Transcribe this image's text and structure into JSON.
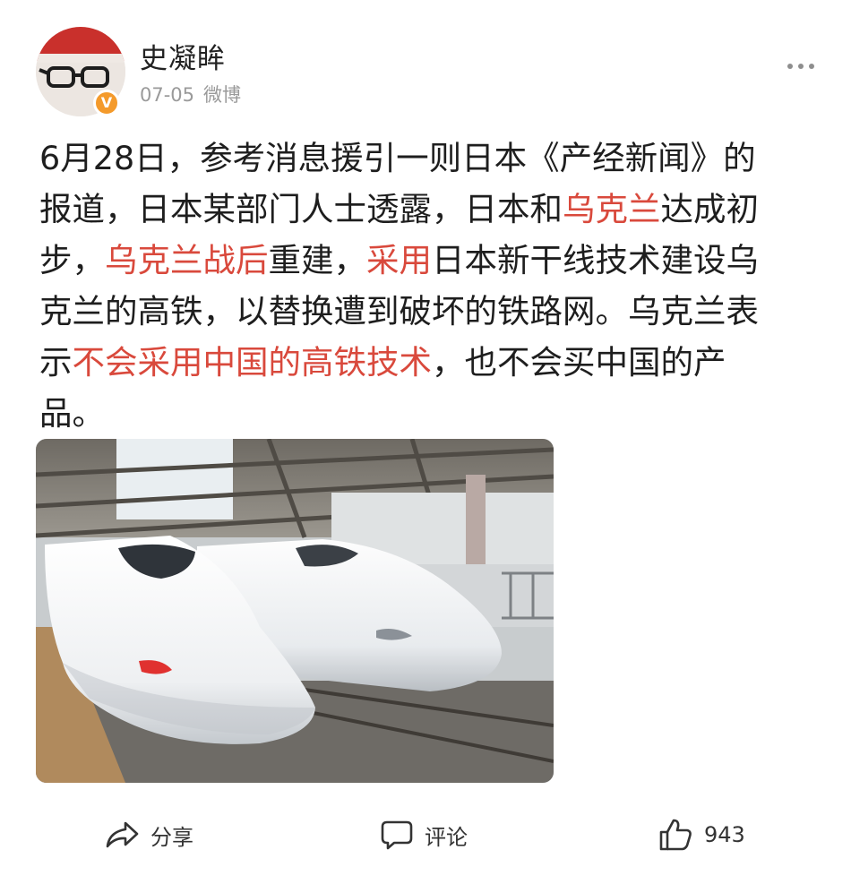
{
  "post": {
    "author": "史凝眸",
    "date": "07-05",
    "source": "微博",
    "verified_badge": "V",
    "text_lines": [
      [
        {
          "t": "6月28日，参考消息援引一则日本《产经新闻》的",
          "hl": false
        }
      ],
      [
        {
          "t": "报道，日本某部门人士透露，日本和",
          "hl": false
        },
        {
          "t": "乌克兰",
          "hl": true
        },
        {
          "t": "达成初",
          "hl": false
        }
      ],
      [
        {
          "t": "步，",
          "hl": false
        },
        {
          "t": "乌克兰战后",
          "hl": true
        },
        {
          "t": "重建，",
          "hl": false
        },
        {
          "t": "采用",
          "hl": true
        },
        {
          "t": "日本新干线技术建设乌",
          "hl": false
        }
      ],
      [
        {
          "t": "克兰的高铁，以替换遭到破坏的铁路网。乌克兰表",
          "hl": false
        }
      ],
      [
        {
          "t": "示",
          "hl": false
        },
        {
          "t": "不会采用中国的高铁技术",
          "hl": true
        },
        {
          "t": "，也不会买中国的产",
          "hl": false
        }
      ],
      [
        {
          "t": "品。",
          "hl": false
        }
      ]
    ],
    "highlight_color": "#d9493c"
  },
  "actions": {
    "share_label": "分享",
    "comment_label": "评论",
    "like_count": "943"
  },
  "icons": {
    "more": "more-dots-icon",
    "share": "share-arrow-icon",
    "comment": "comment-bubble-icon",
    "like": "thumbs-up-icon"
  }
}
